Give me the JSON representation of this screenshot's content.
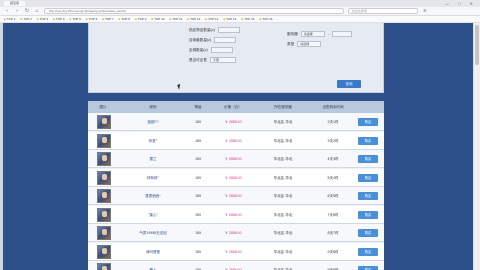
{
  "browser": {
    "tab_title": "藏宝阁",
    "url": "http://xyq.cbg.163.com/cgi-bin/query.py?act=show_search",
    "search_placeholder": "在此处搜索",
    "window_controls": "— □ ✕",
    "bookmarks": [
      "TOP 1",
      "TOP 2",
      "TOP 3",
      "TOP 4",
      "TOP 5",
      "TOP 6",
      "TOP 7",
      "TOP 8",
      "TOP 9",
      "TOP 10",
      "TOP 11",
      "TOP 12",
      "TOP 13",
      "TOP 14",
      "TOP 15",
      "TOP 16"
    ]
  },
  "filters": {
    "row1_label": "指定物品数量(≥)",
    "row2_label": "召唤兽数量(≥)",
    "row3_label": "坐骑数量(≥)",
    "row4_label": "是否可出售",
    "row4_value": "不限",
    "right1_label": "服务器",
    "right1_value": "请选择",
    "right2_label": "类型",
    "right2_value": "请选择",
    "dash": "-"
  },
  "query_button": "查询",
  "table": {
    "headers": [
      "图片",
      "昵称",
      "等级",
      "价格（元）",
      "所在服务器",
      "出售剩余时间"
    ],
    "rows": [
      {
        "name": "饭团??",
        "level": "159",
        "price": "￥ 2888.00",
        "server": "华北区-华北",
        "time": "2天1时",
        "buy": "购买"
      },
      {
        "name": "仲夏°",
        "level": "159",
        "price": "￥ 2888.00",
        "server": "华北区-华北",
        "time": "3天2时",
        "buy": "购买"
      },
      {
        "name": "雪兰",
        "level": "159",
        "price": "￥ 2888.00",
        "server": "华北区-华北",
        "time": "4天3时",
        "buy": "购买"
      },
      {
        "name": "林林林°",
        "level": "159",
        "price": "￥ 2888.00",
        "server": "华北区-华北",
        "time": "5天4时",
        "buy": "购买"
      },
      {
        "name": "潇潇洒洒~",
        "level": "159",
        "price": "￥ 2888.00",
        "server": "华北区-华北",
        "time": "6天5时",
        "buy": "购买"
      },
      {
        "name": "°蜜心°",
        "level": "159",
        "price": "￥ 2888.00",
        "server": "华北区-华北",
        "time": "7天6时",
        "buy": "购买"
      },
      {
        "name": "气质19988无法回",
        "level": "159",
        "price": "￥ 2888.00",
        "server": "华北区-华北",
        "time": "8天7时",
        "buy": "购买"
      },
      {
        "name": "我叫爸爸",
        "level": "159",
        "price": "￥ 2888.00",
        "server": "华北区-华北",
        "time": "9天8时",
        "buy": "购买"
      },
      {
        "name": "糖人",
        "level": "159",
        "price": "￥ 2888.00",
        "server": "华北区-华北",
        "time": "9天9时",
        "buy": "购买"
      }
    ]
  }
}
